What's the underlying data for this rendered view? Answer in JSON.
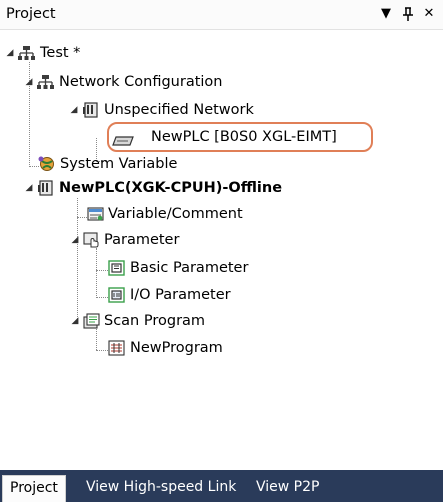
{
  "panel": {
    "title": "Project",
    "controls": {
      "dropdown_icon": "▼",
      "pin_icon": "ᵖ",
      "close_icon": "✕"
    }
  },
  "tree": {
    "root": {
      "label": "Test *",
      "icon": "network-project-icon",
      "expanded": true
    },
    "network_configuration": {
      "label": "Network Configuration",
      "icon": "network-config-icon",
      "expanded": true
    },
    "unspecified_network": {
      "label": "Unspecified Network",
      "icon": "network-device-icon",
      "expanded": true
    },
    "plc_node": {
      "label": "NewPLC [B0S0 XGL-EIMT]",
      "icon": "module-card-icon",
      "highlighted": true,
      "highlight_color": "#e07f57"
    },
    "system_variable": {
      "label": "System Variable",
      "icon": "globe-variable-icon"
    },
    "plc_project": {
      "label": "NewPLC(XGK-CPUH)-Offline",
      "icon": "plc-cpu-icon",
      "expanded": true,
      "bold": true
    },
    "variable_comment": {
      "label": "Variable/Comment",
      "icon": "variable-comment-icon"
    },
    "parameter": {
      "label": "Parameter",
      "icon": "parameter-hand-icon",
      "expanded": true
    },
    "basic_parameter": {
      "label": "Basic Parameter",
      "icon": "basic-parameter-icon"
    },
    "io_parameter": {
      "label": "I/O Parameter",
      "icon": "io-parameter-icon"
    },
    "scan_program": {
      "label": "Scan Program",
      "icon": "scan-program-icon",
      "expanded": true
    },
    "new_program": {
      "label": "NewProgram",
      "icon": "program-ladder-icon"
    }
  },
  "tabs": [
    {
      "label": "Project",
      "active": true
    },
    {
      "label": "View High-speed Link",
      "active": false
    },
    {
      "label": "View P2P",
      "active": false
    }
  ],
  "colors": {
    "tab_bar_background": "#2a3b5a",
    "highlight_border": "#e07f57"
  }
}
